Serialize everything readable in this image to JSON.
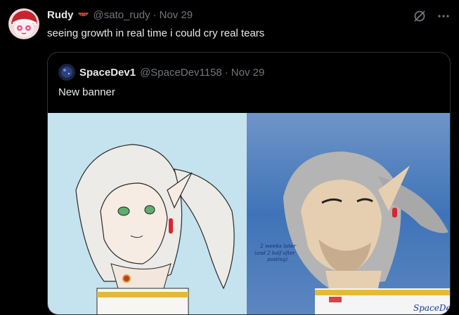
{
  "tweet": {
    "author_name": "Rudy",
    "author_emoji": "watermelon",
    "handle": "@sato_rudy",
    "separator": "·",
    "date": "Nov 29",
    "text": "seeing growth in real time i could cry real tears"
  },
  "actions": {
    "grok_icon": "slashed-circle-icon",
    "more_icon": "more-icon"
  },
  "quote": {
    "author_name": "SpaceDev1",
    "handle": "@SpaceDev1158",
    "separator": "·",
    "date": "Nov 29",
    "text": "New banner"
  },
  "media": {
    "image": "banner comparison drawing",
    "annotation_line1": "2 weeks later",
    "annotation_line2": "(and 2 half after",
    "annotation_line3": "posting)",
    "signature": "SpaceDev"
  },
  "colors": {
    "background": "#000000",
    "text": "#e7e9ea",
    "muted": "#71767b",
    "border": "#2f3336"
  }
}
